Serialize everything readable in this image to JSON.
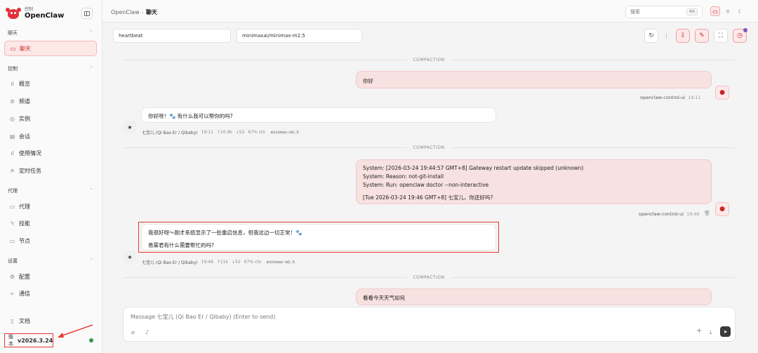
{
  "brand": {
    "sub": "控制",
    "name": "OpenClaw"
  },
  "sidebar": {
    "sections": [
      {
        "title": "聊天"
      },
      {
        "title": "控制"
      },
      {
        "title": "代理"
      },
      {
        "title": "设置"
      }
    ],
    "items": [
      {
        "label": "聊天",
        "icon": "chat-icon"
      },
      {
        "label": "概览",
        "icon": "bar-chart-icon"
      },
      {
        "label": "频道",
        "icon": "link-icon"
      },
      {
        "label": "实例",
        "icon": "broadcast-icon"
      },
      {
        "label": "会话",
        "icon": "document-icon"
      },
      {
        "label": "使用情况",
        "icon": "bar-chart-icon"
      },
      {
        "label": "定时任务",
        "icon": "loader-icon"
      },
      {
        "label": "代理",
        "icon": "folder-icon"
      },
      {
        "label": "技能",
        "icon": "bolt-icon"
      },
      {
        "label": "节点",
        "icon": "monitor-icon"
      },
      {
        "label": "配置",
        "icon": "gear-icon"
      },
      {
        "label": "通信",
        "icon": "send-icon"
      },
      {
        "label": "文档",
        "icon": "book-icon"
      }
    ],
    "version_label": "版本",
    "version": "v2026.3.24"
  },
  "topbar": {
    "breadcrumb_root": "OpenClaw",
    "breadcrumb_sep": "›",
    "breadcrumb_current": "聊天",
    "search_placeholder": "搜索",
    "search_shortcut": "⌘K"
  },
  "session": {
    "session_key": "heartbeat",
    "model": "minimaxai/minimax-m2.5"
  },
  "chat": {
    "compaction_label": "COMPACTION",
    "messages": [
      {
        "role": "user",
        "lines": [
          "你好"
        ],
        "sender": "openclaw-control-ui",
        "time": "19:11"
      },
      {
        "role": "assistant",
        "lines": [
          "你好呀！🐾 有什么我可以帮你的吗?"
        ],
        "sender": "七宝儿 (Qi Bao Er / Qibaby)",
        "time": "19:11",
        "up": "↑10.9k",
        "down": "↓52",
        "ctx": "67% ctx",
        "model": "minimax-m2.5"
      },
      {
        "role": "user",
        "lines": [
          "System: [2026-03-24 19:44:57 GMT+8] Gateway restart update skipped (unknown)",
          "System: Reason: not-git-install",
          "System: Run: openclaw doctor --non-interactive",
          "[Tue 2026-03-24 19:46 GMT+8] 七宝儿，你还好吗?"
        ],
        "sender": "openclaw-control-ui",
        "time": "19:46"
      },
      {
        "role": "assistant",
        "lines": [
          "我很好呀～刚才系统显示了一些重启信息，但我这边一切正常！🐾",
          "易雾君有什么需要帮忙的吗?"
        ],
        "sender": "七宝儿 (Qi Bao Er / Qibaby)",
        "time": "19:46",
        "up": "↑11k",
        "down": "↓52",
        "ctx": "67% ctx",
        "model": "minimax-m2.5"
      },
      {
        "role": "user",
        "lines": [
          "看看今天天气如何"
        ]
      }
    ]
  },
  "composer": {
    "placeholder": "Message 七宝儿 (Qi Bao Er / Qibaby) (Enter to send)"
  },
  "colors": {
    "accent": "#c62828",
    "accent_bg": "#fde8e8",
    "annotation": "#e53935",
    "online": "#2e9b4c"
  }
}
